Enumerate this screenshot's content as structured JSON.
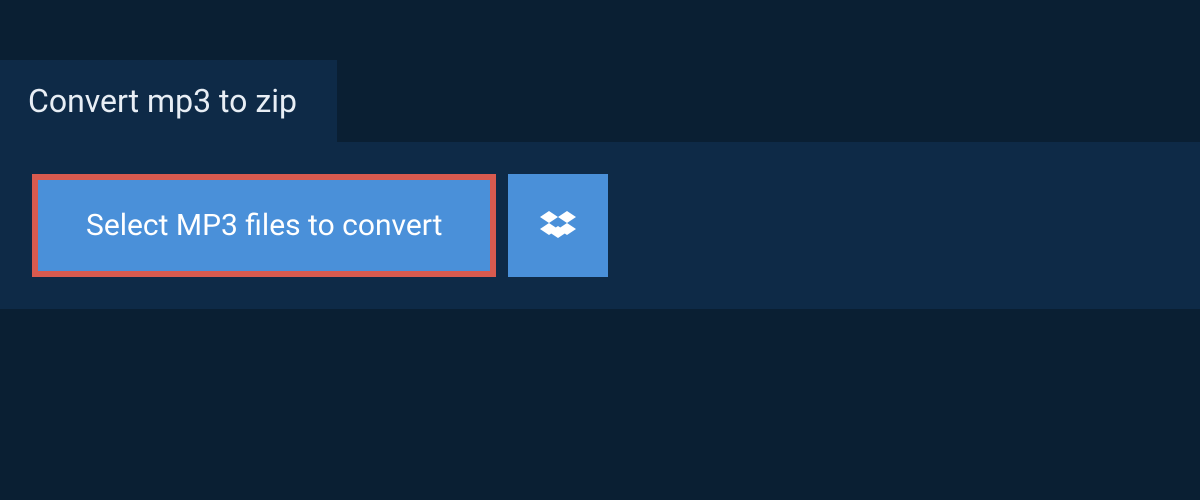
{
  "header": {
    "title": "Convert mp3 to zip"
  },
  "actions": {
    "select_label": "Select MP3 files to convert",
    "dropbox_icon": "dropbox"
  }
}
